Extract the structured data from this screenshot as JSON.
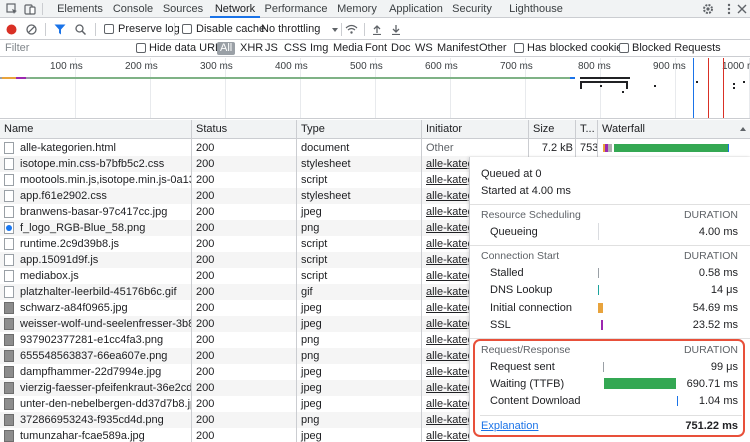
{
  "tabs": [
    "Elements",
    "Console",
    "Sources",
    "Network",
    "Performance",
    "Memory",
    "Application",
    "Security",
    "Lighthouse"
  ],
  "toolbar": {
    "preserve_log": "Preserve log",
    "disable_cache": "Disable cache",
    "throttling": "No throttling"
  },
  "filter": {
    "placeholder": "Filter",
    "hide_data_urls": "Hide data URLs",
    "types": [
      "All",
      "XHR",
      "JS",
      "CSS",
      "Img",
      "Media",
      "Font",
      "Doc",
      "WS",
      "Manifest",
      "Other"
    ],
    "has_blocked_cookies": "Has blocked cookies",
    "blocked_requests": "Blocked Requests"
  },
  "overview": {
    "ticks": [
      "100 ms",
      "200 ms",
      "300 ms",
      "400 ms",
      "500 ms",
      "600 ms",
      "700 ms",
      "800 ms",
      "900 ms",
      "1000 ms"
    ]
  },
  "table": {
    "columns": [
      "Name",
      "Status",
      "Type",
      "Initiator",
      "Size",
      "T...",
      "Waterfall"
    ],
    "rows": [
      {
        "name": "alle-kategorien.html",
        "status": "200",
        "type": "document",
        "initiator": "Other",
        "size": "7.2 kB",
        "time": "753...",
        "icon": "doc"
      },
      {
        "name": "isotope.min.css-b7bfb5c2.css",
        "status": "200",
        "type": "stylesheet",
        "initiator": "alle-katego",
        "icon": "doc"
      },
      {
        "name": "mootools.min.js,isotope.min.js-0a1381...",
        "status": "200",
        "type": "script",
        "initiator": "alle-katego",
        "icon": "doc"
      },
      {
        "name": "app.f61e2902.css",
        "status": "200",
        "type": "stylesheet",
        "initiator": "alle-katego",
        "icon": "doc"
      },
      {
        "name": "branwens-basar-97c417cc.jpg",
        "status": "200",
        "type": "jpeg",
        "initiator": "alle-katego",
        "icon": "doc"
      },
      {
        "name": "f_logo_RGB-Blue_58.png",
        "status": "200",
        "type": "png",
        "initiator": "alle-katego",
        "icon": "fb"
      },
      {
        "name": "runtime.2c9d39b8.js",
        "status": "200",
        "type": "script",
        "initiator": "alle-katego",
        "icon": "doc"
      },
      {
        "name": "app.15091d9f.js",
        "status": "200",
        "type": "script",
        "initiator": "alle-katego",
        "icon": "doc"
      },
      {
        "name": "mediabox.js",
        "status": "200",
        "type": "script",
        "initiator": "alle-katego",
        "icon": "doc"
      },
      {
        "name": "platzhalter-leerbild-45176b6c.gif",
        "status": "200",
        "type": "gif",
        "initiator": "alle-katego",
        "icon": "doc"
      },
      {
        "name": "schwarz-a84f0965.jpg",
        "status": "200",
        "type": "jpeg",
        "initiator": "alle-katego",
        "icon": "img"
      },
      {
        "name": "weisser-wolf-und-seelenfresser-3b836c...",
        "status": "200",
        "type": "jpeg",
        "initiator": "alle-katego",
        "icon": "img"
      },
      {
        "name": "937902377281-e1cc4fa3.png",
        "status": "200",
        "type": "png",
        "initiator": "alle-katego",
        "icon": "img"
      },
      {
        "name": "655548563837-66ea607e.png",
        "status": "200",
        "type": "png",
        "initiator": "alle-katego",
        "icon": "img"
      },
      {
        "name": "dampfhammer-22d7994e.jpg",
        "status": "200",
        "type": "jpeg",
        "initiator": "alle-katego",
        "icon": "img"
      },
      {
        "name": "vierzig-faesser-pfeifenkraut-36e2cd56.jpg",
        "status": "200",
        "type": "jpeg",
        "initiator": "alle-katego",
        "icon": "img"
      },
      {
        "name": "unter-den-nebelbergen-dd37d7b8.jpg",
        "status": "200",
        "type": "jpeg",
        "initiator": "alle-katego",
        "icon": "img"
      },
      {
        "name": "372866953243-f935cd4d.png",
        "status": "200",
        "type": "png",
        "initiator": "alle-katego",
        "icon": "img"
      },
      {
        "name": "tumunzahar-fcae589a.jpg",
        "status": "200",
        "type": "jpeg",
        "initiator": "alle-katego",
        "icon": "img"
      }
    ]
  },
  "timing": {
    "queued_at": "Queued at 0",
    "started_at": "Started at 4.00 ms",
    "duration_header": "DURATION",
    "sections": [
      {
        "title": "Resource Scheduling",
        "items": [
          {
            "label": "Queueing",
            "value": "4.00 ms",
            "color": "#e8eaed"
          }
        ]
      },
      {
        "title": "Connection Start",
        "items": [
          {
            "label": "Stalled",
            "value": "0.58 ms",
            "color": "#9aa0a6"
          },
          {
            "label": "DNS Lookup",
            "value": "14 μs",
            "color": "#1ba39c"
          },
          {
            "label": "Initial connection",
            "value": "54.69 ms",
            "color": "#e8a33c"
          },
          {
            "label": "SSL",
            "value": "23.52 ms",
            "color": "#9c27b0"
          }
        ]
      },
      {
        "title": "Request/Response",
        "items": [
          {
            "label": "Request sent",
            "value": "99 μs",
            "color": "#9aa0a6"
          },
          {
            "label": "Waiting (TTFB)",
            "value": "690.71 ms",
            "color": "#34a853"
          },
          {
            "label": "Content Download",
            "value": "1.04 ms",
            "color": "#1a73e8"
          }
        ]
      }
    ],
    "explanation": "Explanation",
    "total": "751.22 ms"
  }
}
